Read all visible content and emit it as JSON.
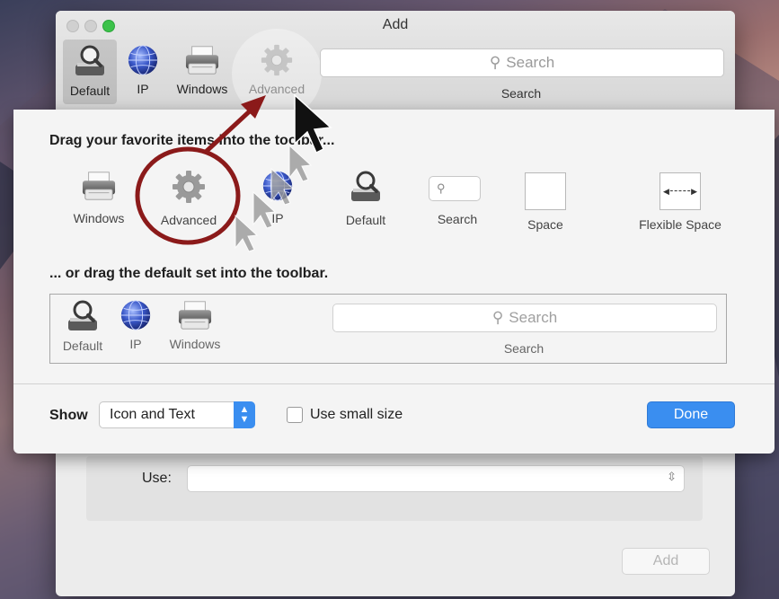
{
  "window": {
    "title": "Add",
    "toolbar": [
      {
        "label": "Default",
        "icon": "magnifier-scan-icon"
      },
      {
        "label": "IP",
        "icon": "globe-icon"
      },
      {
        "label": "Windows",
        "icon": "printer-icon"
      },
      {
        "label": "Advanced",
        "icon": "gear-icon"
      }
    ],
    "search_placeholder": "Search",
    "search_label": "Search",
    "use_label": "Use:",
    "add_button": "Add"
  },
  "sheet": {
    "heading1": "Drag your favorite items into the toolbar...",
    "palette": [
      {
        "label": "Windows",
        "icon": "printer-icon"
      },
      {
        "label": "Advanced",
        "icon": "gear-icon"
      },
      {
        "label": "IP",
        "icon": "globe-icon"
      },
      {
        "label": "Default",
        "icon": "magnifier-scan-icon"
      },
      {
        "label": "Search",
        "icon": "search-field-icon"
      },
      {
        "label": "Space",
        "icon": "space-icon"
      },
      {
        "label": "Flexible Space",
        "icon": "flexible-space-icon"
      }
    ],
    "heading2": "... or drag the default set into the toolbar.",
    "default_set": [
      {
        "label": "Default"
      },
      {
        "label": "IP"
      },
      {
        "label": "Windows"
      }
    ],
    "default_search_placeholder": "Search",
    "default_search_label": "Search",
    "show_label": "Show",
    "show_value": "Icon and Text",
    "small_size_label": "Use small size",
    "small_size_checked": false,
    "done_button": "Done"
  },
  "colors": {
    "accent": "#3a8ef0",
    "annotation": "#8b1a1a"
  }
}
